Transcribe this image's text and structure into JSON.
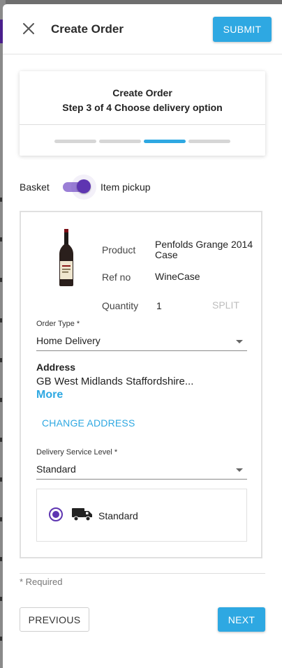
{
  "header": {
    "title": "Create Order",
    "submit_label": "SUBMIT",
    "close_icon": "close-icon"
  },
  "stepper": {
    "title": "Create Order",
    "subtitle": "Step 3 of 4 Choose delivery option",
    "current_step": 3,
    "total_steps": 4,
    "active_color": "#2ea8e2"
  },
  "mode_toggle": {
    "left_label": "Basket",
    "right_label": "Item pickup",
    "on": true,
    "color": "#5e35b1"
  },
  "item": {
    "image": "wine-bottle-icon",
    "product_label": "Product",
    "product_line1": "Penfolds Grange 2014",
    "product_line2": "Case",
    "ref_label": "Ref no",
    "ref_value": "WineCase",
    "quantity_label": "Quantity",
    "quantity_value": "1",
    "split_label": "SPLIT"
  },
  "order_type": {
    "label": "Order Type *",
    "value": "Home Delivery"
  },
  "address": {
    "heading": "Address",
    "value": "GB West Midlands Staffordshire...",
    "more_label": "More",
    "change_label": "CHANGE ADDRESS"
  },
  "delivery_service": {
    "label": "Delivery Service Level *",
    "value": "Standard",
    "option_label": "Standard",
    "option_selected": true,
    "option_icon": "truck-icon"
  },
  "footer": {
    "required_note": "* Required",
    "previous_label": "PREVIOUS",
    "next_label": "NEXT"
  }
}
